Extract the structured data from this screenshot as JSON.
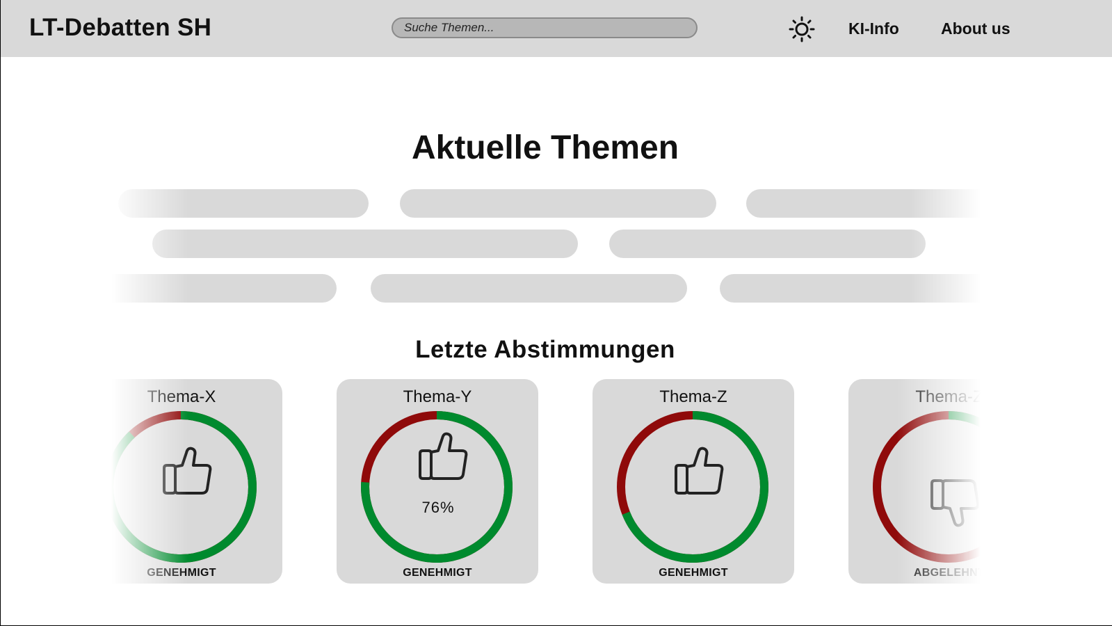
{
  "header": {
    "brand": "LT-Debatten SH",
    "search_placeholder": "Suche Themen...",
    "theme_toggle_icon": "sun-icon",
    "nav": [
      {
        "label": "KI-Info"
      },
      {
        "label": "About us"
      }
    ]
  },
  "topics": {
    "title": "Aktuelle Themen"
  },
  "votes": {
    "title": "Letzte Abstimmungen",
    "colors": {
      "approve": "#008a2e",
      "reject": "#8f0a0a"
    },
    "cards": [
      {
        "title": "Thema-X",
        "approve_fraction": 0.88,
        "icon": "thumbs-up-icon",
        "status": "GENEHMIGT"
      },
      {
        "title": "Thema-Y",
        "approve_fraction": 0.76,
        "percent": "76%",
        "icon": "thumbs-up-icon",
        "status": "GENEHMIGT"
      },
      {
        "title": "Thema-Z",
        "approve_fraction": 0.69,
        "icon": "thumbs-up-icon",
        "status": "GENEHMIGT"
      },
      {
        "title": "Thema-Z",
        "approve_fraction": 0.13,
        "icon": "thumbs-down-icon",
        "status": "ABGELEHNT"
      }
    ]
  }
}
